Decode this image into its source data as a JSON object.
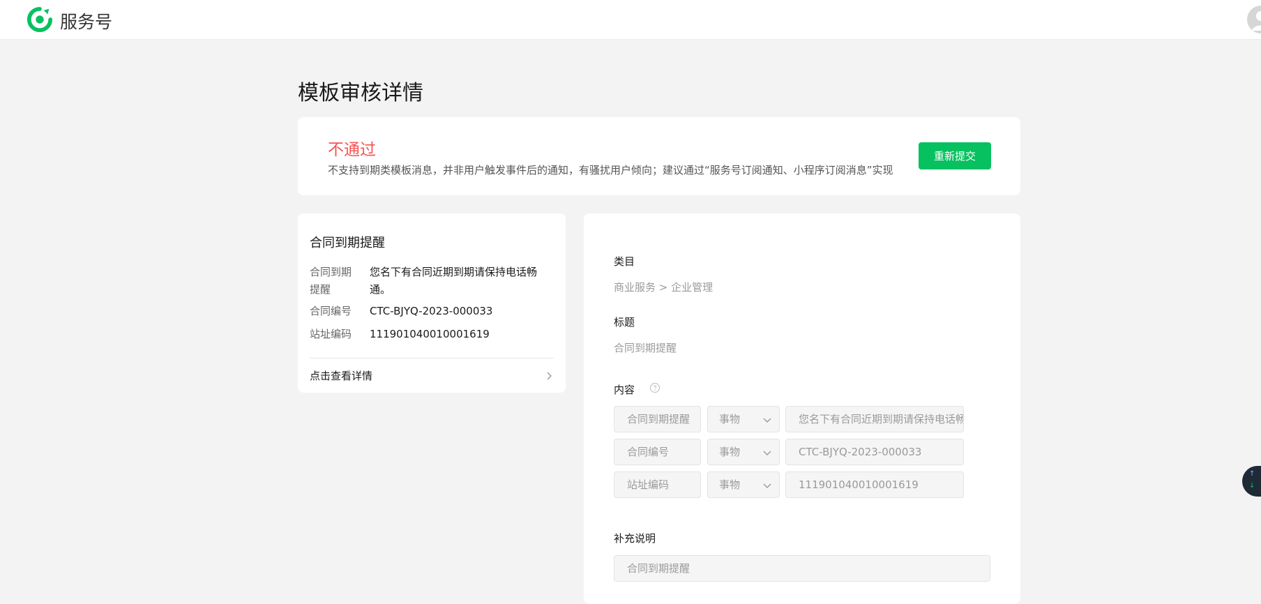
{
  "app": {
    "brand": "服务号",
    "brand_color": "#07c160"
  },
  "page": {
    "title": "模板审核详情"
  },
  "review": {
    "status": "不通过",
    "status_color": "#fa5151",
    "reason": "不支持到期类模板消息，并非用户触发事件后的通知，有骚扰用户倾向；建议通过“服务号订阅通知、小程序订阅消息”实现",
    "resubmit_label": "重新提交"
  },
  "preview": {
    "title": "合同到期提醒",
    "fields": [
      {
        "label": "合同到期提醒",
        "value": "您名下有合同近期到期请保持电话畅通。"
      },
      {
        "label": "合同编号",
        "value": "CTC-BJYQ-2023-000033"
      },
      {
        "label": "站址编码",
        "value": "111901040010001619"
      }
    ],
    "detail_link": "点击查看详情"
  },
  "form": {
    "category_label": "类目",
    "category_value": "商业服务 > 企业管理",
    "title_label": "标题",
    "title_value": "合同到期提醒",
    "content_label": "内容",
    "content_rows": [
      {
        "key": "合同到期提醒",
        "type": "事物",
        "value": "您名下有合同近期到期请保持电话畅通。"
      },
      {
        "key": "合同编号",
        "type": "事物",
        "value": "CTC-BJYQ-2023-000033"
      },
      {
        "key": "站址编码",
        "type": "事物",
        "value": "111901040010001619"
      }
    ],
    "supplement_label": "补充说明",
    "supplement_value": "合同到期提醒"
  },
  "floating": {
    "icons": [
      "arrow-up-icon",
      "arrow-down-icon"
    ]
  }
}
